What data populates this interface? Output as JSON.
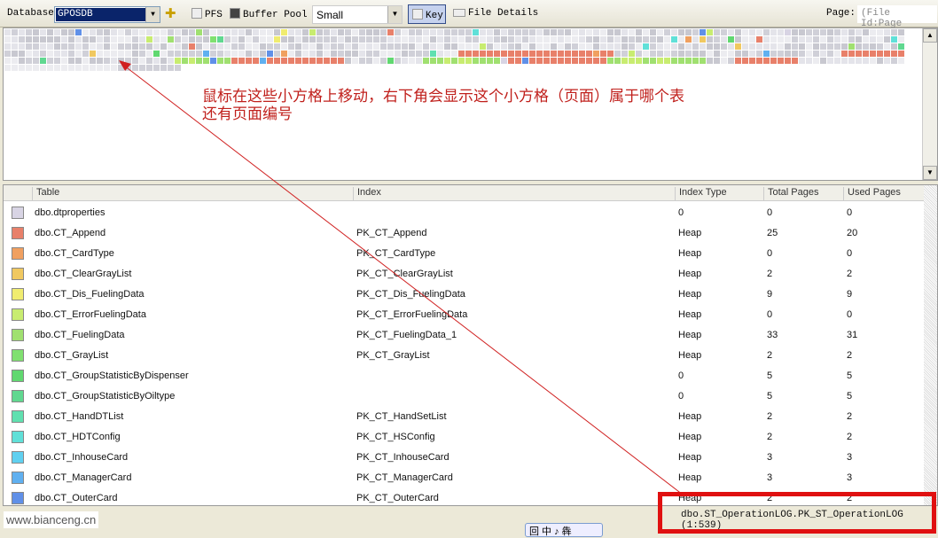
{
  "toolbar": {
    "database_label": "Database",
    "database_value": "GPOSDB",
    "pfs_label": "PFS",
    "buffer_pool_label": "Buffer Pool",
    "size_value": "Small",
    "key_label": "Key",
    "file_details_label": "File Details",
    "page_label": "Page:",
    "page_value": "(File Id:Page"
  },
  "annotation": {
    "line1": "鼠标在这些小方格上移动，右下角会显示这个小方格（页面）属于哪个表",
    "line2": "还有页面编号"
  },
  "table": {
    "columns": [
      "Table",
      "Index",
      "Index Type",
      "Total Pages",
      "Used Pages"
    ],
    "rows": [
      {
        "color": "#d8d4e4",
        "table": "dbo.dtproperties",
        "index": "",
        "type": "0",
        "total": "0",
        "used": "0"
      },
      {
        "color": "#e8806a",
        "table": "dbo.CT_Append",
        "index": "PK_CT_Append",
        "type": "Heap",
        "total": "25",
        "used": "20"
      },
      {
        "color": "#f0a060",
        "table": "dbo.CT_CardType",
        "index": "PK_CT_CardType",
        "type": "Heap",
        "total": "0",
        "used": "0"
      },
      {
        "color": "#f0c860",
        "table": "dbo.CT_ClearGrayList",
        "index": "PK_CT_ClearGrayList",
        "type": "Heap",
        "total": "2",
        "used": "2"
      },
      {
        "color": "#f0ec70",
        "table": "dbo.CT_Dis_FuelingData",
        "index": "PK_CT_Dis_FuelingData",
        "type": "Heap",
        "total": "9",
        "used": "9"
      },
      {
        "color": "#c8ec70",
        "table": "dbo.CT_ErrorFuelingData",
        "index": "PK_CT_ErrorFuelingData",
        "type": "Heap",
        "total": "0",
        "used": "0"
      },
      {
        "color": "#a0e070",
        "table": "dbo.CT_FuelingData",
        "index": "PK_CT_FuelingData_1",
        "type": "Heap",
        "total": "33",
        "used": "31"
      },
      {
        "color": "#80e070",
        "table": "dbo.CT_GrayList",
        "index": "PK_CT_GrayList",
        "type": "Heap",
        "total": "2",
        "used": "2"
      },
      {
        "color": "#60d870",
        "table": "dbo.CT_GroupStatisticByDispenser",
        "index": "",
        "type": "0",
        "total": "5",
        "used": "5"
      },
      {
        "color": "#60d890",
        "table": "dbo.CT_GroupStatisticByOiltype",
        "index": "",
        "type": "0",
        "total": "5",
        "used": "5"
      },
      {
        "color": "#60e0b0",
        "table": "dbo.CT_HandDTList",
        "index": "PK_CT_HandSetList",
        "type": "Heap",
        "total": "2",
        "used": "2"
      },
      {
        "color": "#60e0d8",
        "table": "dbo.CT_HDTConfig",
        "index": "PK_CT_HSConfig",
        "type": "Heap",
        "total": "2",
        "used": "2"
      },
      {
        "color": "#60d0f0",
        "table": "dbo.CT_InhouseCard",
        "index": "PK_CT_InhouseCard",
        "type": "Heap",
        "total": "3",
        "used": "3"
      },
      {
        "color": "#60b0f0",
        "table": "dbo.CT_ManagerCard",
        "index": "PK_CT_ManagerCard",
        "type": "Heap",
        "total": "3",
        "used": "3"
      },
      {
        "color": "#6090e8",
        "table": "dbo.CT_OuterCard",
        "index": "PK_CT_OuterCard",
        "type": "Heap",
        "total": "2",
        "used": "2"
      }
    ]
  },
  "status": {
    "watermark": "www.bianceng.cn",
    "hover_info": "dbo.ST_OperationLOG.PK_ST_OperationLOG (1:539)",
    "ime": "回 中 ♪ 犇"
  },
  "colors": {
    "highlight": "#e01010",
    "annotation": "#c0201c",
    "selection": "#0a246a"
  }
}
